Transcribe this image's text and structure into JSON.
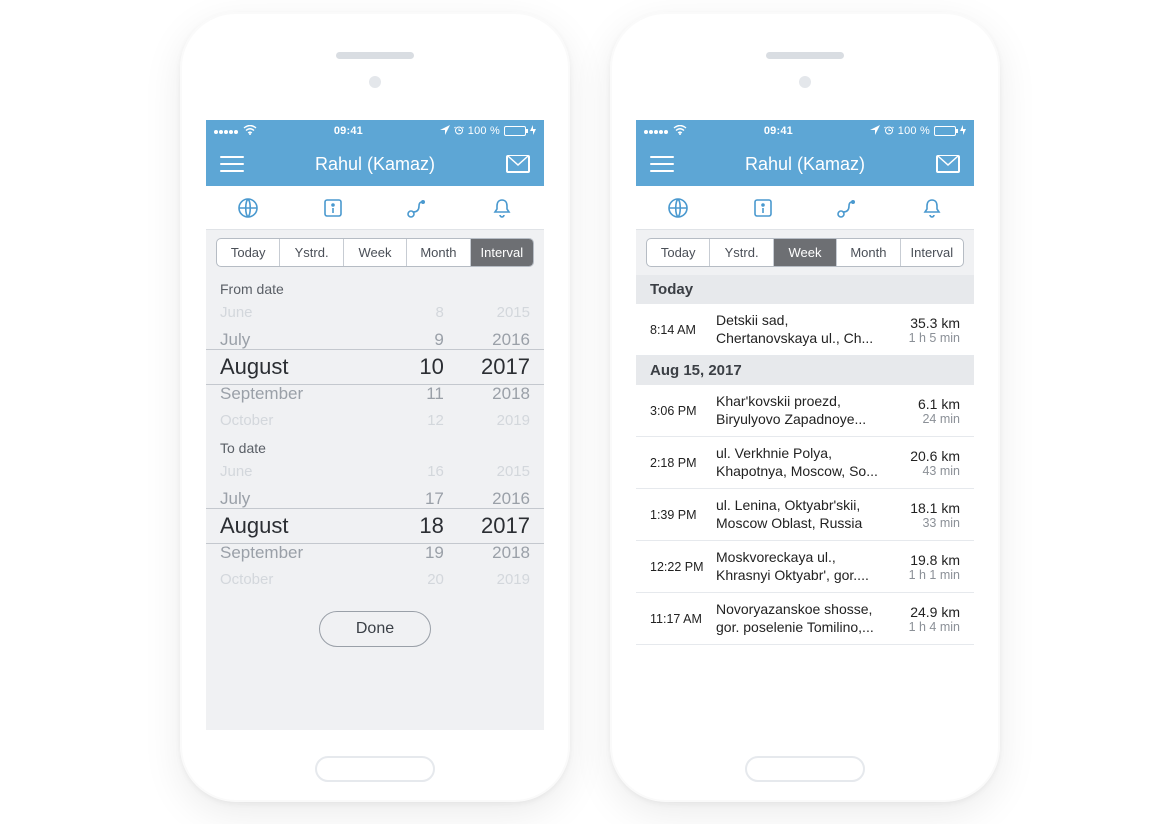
{
  "status": {
    "time": "09:41",
    "battery_text": "100 %"
  },
  "header": {
    "title": "Rahul (Kamaz)"
  },
  "segments": [
    "Today",
    "Ystrd.",
    "Week",
    "Month",
    "Interval"
  ],
  "left": {
    "active_segment": "Interval",
    "from_label": "From date",
    "to_label": "To date",
    "done_label": "Done",
    "from": {
      "months": [
        "June",
        "July",
        "August",
        "September",
        "October"
      ],
      "days": [
        "8",
        "9",
        "10",
        "11",
        "12"
      ],
      "years": [
        "2015",
        "2016",
        "2017",
        "2018",
        "2019"
      ]
    },
    "to": {
      "months": [
        "June",
        "July",
        "August",
        "September",
        "October"
      ],
      "days": [
        "16",
        "17",
        "18",
        "19",
        "20"
      ],
      "years": [
        "2015",
        "2016",
        "2017",
        "2018",
        "2019"
      ]
    }
  },
  "right": {
    "active_segment": "Week",
    "sections": [
      {
        "header": "Today",
        "rows": [
          {
            "time": "8:14 AM",
            "addr1": "Detskii sad,",
            "addr2": "Chertanovskaya ul., Ch...",
            "dist": "35.3 km",
            "dur": "1 h 5 min"
          }
        ]
      },
      {
        "header": "Aug 15, 2017",
        "rows": [
          {
            "time": "3:06 PM",
            "addr1": "Khar'kovskii proezd,",
            "addr2": "Biryulyovo Zapadnoye...",
            "dist": "6.1 km",
            "dur": "24 min"
          },
          {
            "time": "2:18 PM",
            "addr1": "ul. Verkhnie Polya,",
            "addr2": "Khapotnya, Moscow, So...",
            "dist": "20.6 km",
            "dur": "43 min"
          },
          {
            "time": "1:39 PM",
            "addr1": "ul. Lenina, Oktyabr'skii,",
            "addr2": "Moscow Oblast, Russia",
            "dist": "18.1 km",
            "dur": "33 min"
          },
          {
            "time": "12:22 PM",
            "addr1": "Moskvoreckaya ul.,",
            "addr2": "Khrasnyi Oktyabr', gor....",
            "dist": "19.8 km",
            "dur": "1 h 1 min"
          },
          {
            "time": "11:17 AM",
            "addr1": "Novoryazanskoe shosse,",
            "addr2": "gor. poselenie Tomilino,...",
            "dist": "24.9 km",
            "dur": "1 h 4 min"
          }
        ]
      }
    ]
  }
}
